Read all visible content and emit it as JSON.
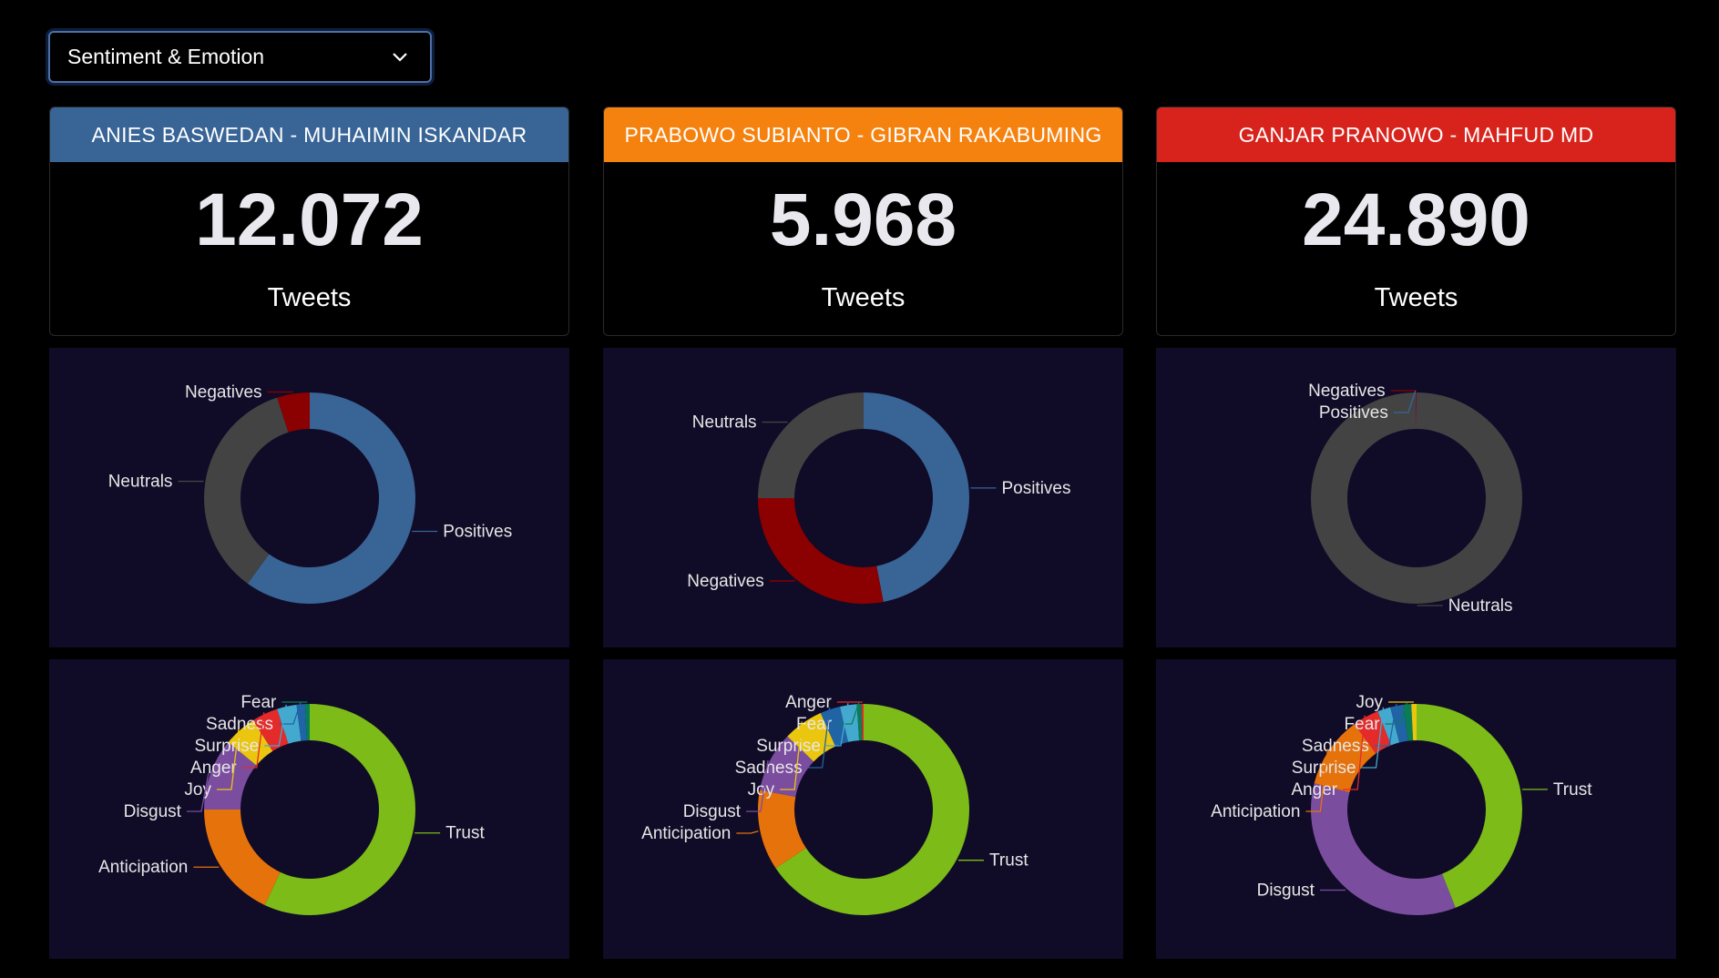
{
  "dropdown": {
    "selected": "Sentiment & Emotion"
  },
  "candidates": [
    {
      "name": "ANIES BASWEDAN - MUHAIMIN ISKANDAR",
      "color": "#386496",
      "count": "12.072",
      "unit": "Tweets"
    },
    {
      "name": "PRABOWO SUBIANTO - GIBRAN RAKABUMING",
      "color": "#f5820f",
      "count": "5.968",
      "unit": "Tweets"
    },
    {
      "name": "GANJAR PRANOWO - MAHFUD MD",
      "color": "#d8231d",
      "count": "24.890",
      "unit": "Tweets"
    }
  ],
  "colors": {
    "Positives": "#386496",
    "Negatives": "#8b0000",
    "Neutrals": "#434343",
    "Trust": "#7cbb18",
    "Anticipation": "#e6720c",
    "Disgust": "#7b4d9f",
    "Joy": "#ebc60e",
    "Anger": "#e52a2a",
    "Surprise": "#44a9cf",
    "Sadness": "#2064a6",
    "Fear": "#0a7d56"
  },
  "chart_data": [
    {
      "type": "pie",
      "chart": "sentiment",
      "candidate": "ANIES BASWEDAN - MUHAIMIN ISKANDAR",
      "labels": [
        "Positives",
        "Neutrals",
        "Negatives"
      ],
      "values": [
        60,
        35,
        5
      ]
    },
    {
      "type": "pie",
      "chart": "sentiment",
      "candidate": "PRABOWO SUBIANTO - GIBRAN RAKABUMING",
      "labels": [
        "Positives",
        "Negatives",
        "Neutrals"
      ],
      "values": [
        47,
        28,
        25
      ]
    },
    {
      "type": "pie",
      "chart": "sentiment",
      "candidate": "GANJAR PRANOWO - MAHFUD MD",
      "labels": [
        "Neutrals",
        "Positives",
        "Negatives"
      ],
      "values": [
        99.8,
        0.1,
        0.1
      ]
    },
    {
      "type": "pie",
      "chart": "emotion",
      "candidate": "ANIES BASWEDAN - MUHAIMIN ISKANDAR",
      "labels": [
        "Trust",
        "Anticipation",
        "Disgust",
        "Joy",
        "Anger",
        "Surprise",
        "Sadness",
        "Fear"
      ],
      "values": [
        57,
        18,
        11,
        5,
        4,
        3,
        1.3,
        0.7
      ]
    },
    {
      "type": "pie",
      "chart": "emotion",
      "candidate": "PRABOWO SUBIANTO - GIBRAN RAKABUMING",
      "labels": [
        "Trust",
        "Anticipation",
        "Disgust",
        "Joy",
        "Sadness",
        "Surprise",
        "Fear",
        "Anger"
      ],
      "values": [
        64,
        12,
        9,
        6,
        3,
        2.5,
        0.7,
        0.3
      ]
    },
    {
      "type": "pie",
      "chart": "emotion",
      "candidate": "GANJAR PRANOWO - MAHFUD MD",
      "labels": [
        "Trust",
        "Disgust",
        "Anticipation",
        "Anger",
        "Surprise",
        "Sadness",
        "Fear",
        "Joy"
      ],
      "values": [
        44,
        35,
        11,
        4,
        2,
        2,
        1.2,
        0.8
      ]
    }
  ]
}
